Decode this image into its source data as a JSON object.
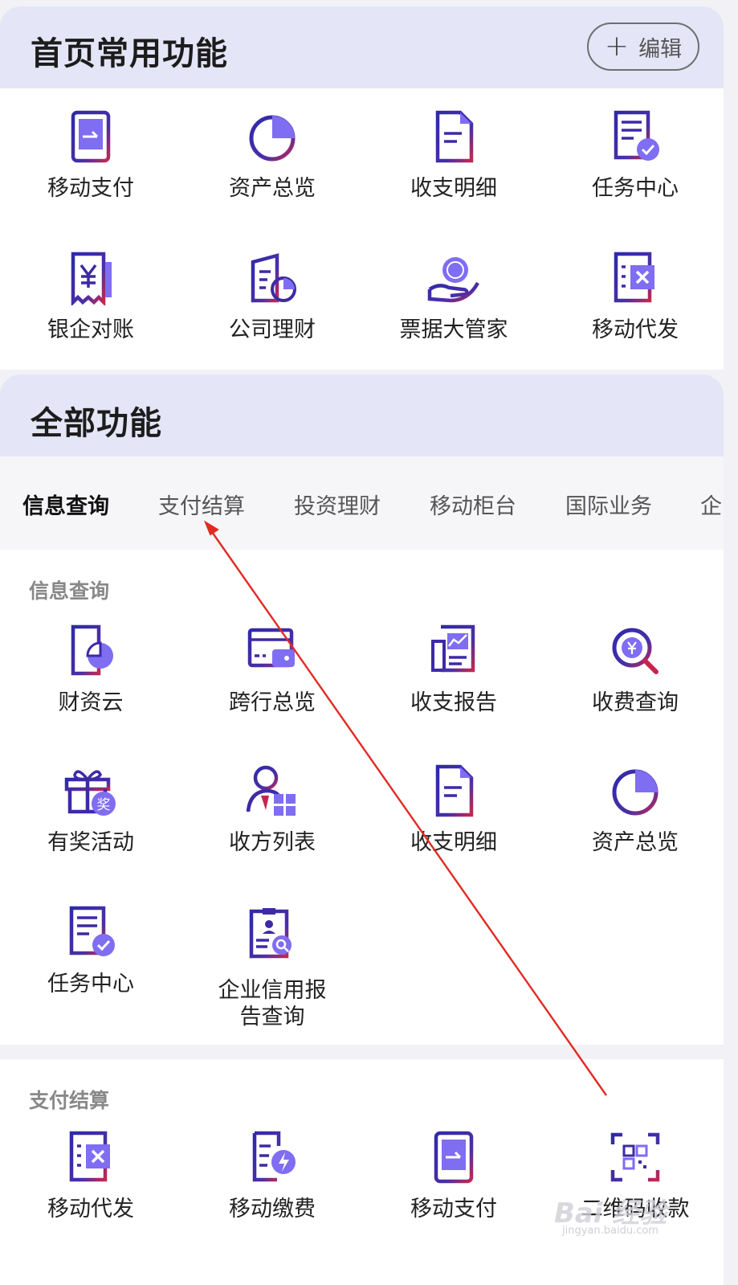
{
  "favorites": {
    "title": "首页常用功能",
    "edit_label": "编辑",
    "items": [
      {
        "label": "移动支付",
        "icon": "mobile-payment-icon"
      },
      {
        "label": "资产总览",
        "icon": "pie-chart-icon"
      },
      {
        "label": "收支明细",
        "icon": "document-icon"
      },
      {
        "label": "任务中心",
        "icon": "task-check-icon"
      },
      {
        "label": "银企对账",
        "icon": "yuan-receipt-icon"
      },
      {
        "label": "公司理财",
        "icon": "building-chart-icon"
      },
      {
        "label": "票据大管家",
        "icon": "bill-hand-icon"
      },
      {
        "label": "移动代发",
        "icon": "excel-sheet-icon"
      }
    ]
  },
  "all": {
    "title": "全部功能",
    "tabs": [
      "信息查询",
      "支付结算",
      "投资理财",
      "移动柜台",
      "国际业务",
      "企"
    ],
    "active_tab": "信息查询",
    "info_section": {
      "title": "信息查询",
      "items": [
        {
          "label": "财资云",
          "icon": "cloud-doc-icon"
        },
        {
          "label": "跨行总览",
          "icon": "wallet-card-icon"
        },
        {
          "label": "收支报告",
          "icon": "report-chart-icon"
        },
        {
          "label": "收费查询",
          "icon": "yuan-search-icon"
        },
        {
          "label": "有奖活动",
          "icon": "gift-icon"
        },
        {
          "label": "收方列表",
          "icon": "user-grid-icon"
        },
        {
          "label": "收支明细",
          "icon": "document-icon"
        },
        {
          "label": "资产总览",
          "icon": "pie-chart-icon"
        },
        {
          "label": "任务中心",
          "icon": "task-check-icon"
        },
        {
          "label": "企业信用报告查询",
          "icon": "credit-report-icon"
        }
      ]
    },
    "pay_section": {
      "title": "支付结算",
      "items": [
        {
          "label": "移动代发",
          "icon": "excel-sheet-icon"
        },
        {
          "label": "移动缴费",
          "icon": "bolt-doc-icon"
        },
        {
          "label": "移动支付",
          "icon": "mobile-payment-icon"
        },
        {
          "label": "二维码收款",
          "icon": "qr-code-icon"
        }
      ]
    }
  },
  "watermark": {
    "text": "Bai 经验",
    "sub": "jingyan.baidu.com"
  },
  "colors": {
    "icon_primary": "#3d2aa6",
    "icon_accent": "#7f6df2",
    "icon_red": "#c4254f",
    "arrow": "#e02b23",
    "band": "#e4e5f7"
  }
}
